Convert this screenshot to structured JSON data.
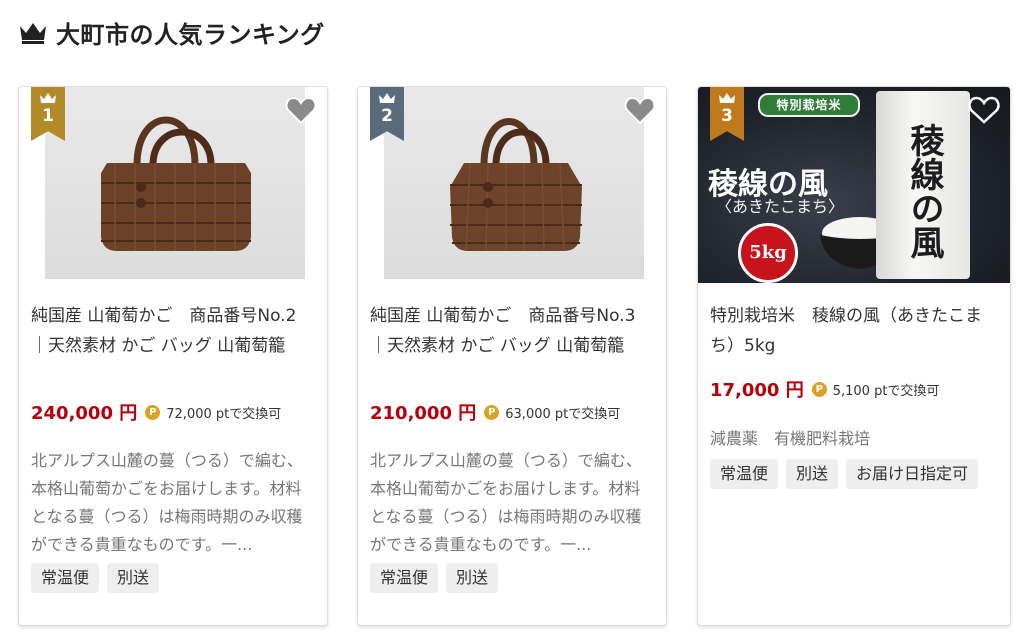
{
  "header": {
    "title": "大町市の人気ランキング",
    "icon": "crown-icon"
  },
  "colors": {
    "price": "#b8000a",
    "rank1": "#b3892a",
    "rank2": "#5a6b7c",
    "rank3": "#bf7a1d"
  },
  "cards": [
    {
      "rank": "1",
      "title": "純国産 山葡萄かご　商品番号No.2｜天然素材 かご バッグ 山葡萄籠",
      "price": "240,000 円",
      "points": "72,000 ptで交換可",
      "description": "北アルプス山麓の蔓（つる）で編む、本格山葡萄かごをお届けします。材料となる蔓（つる）は梅雨時期のみ収穫ができる貴重なものです。一...",
      "tags": [
        "常温便",
        "別送"
      ]
    },
    {
      "rank": "2",
      "title": "純国産 山葡萄かご　商品番号No.3｜天然素材 かご バッグ 山葡萄籠",
      "price": "210,000 円",
      "points": "63,000 ptで交換可",
      "description": "北アルプス山麓の蔓（つる）で編む、本格山葡萄かごをお届けします。材料となる蔓（つる）は梅雨時期のみ収穫ができる貴重なものです。一...",
      "tags": [
        "常温便",
        "別送"
      ]
    },
    {
      "rank": "3",
      "title": "特別栽培米　稜線の風（あきたこまち）5kg",
      "price": "17,000 円",
      "points": "5,100 ptで交換可",
      "features": "減農薬　有機肥料栽培",
      "tags": [
        "常温便",
        "別送",
        "お届け日指定可"
      ],
      "image_text": {
        "banner": "特別栽培米",
        "name": "稜線の風",
        "sub": "〈あきたこまち〉",
        "weight": "5kg",
        "bag": "稜線の風"
      }
    }
  ]
}
